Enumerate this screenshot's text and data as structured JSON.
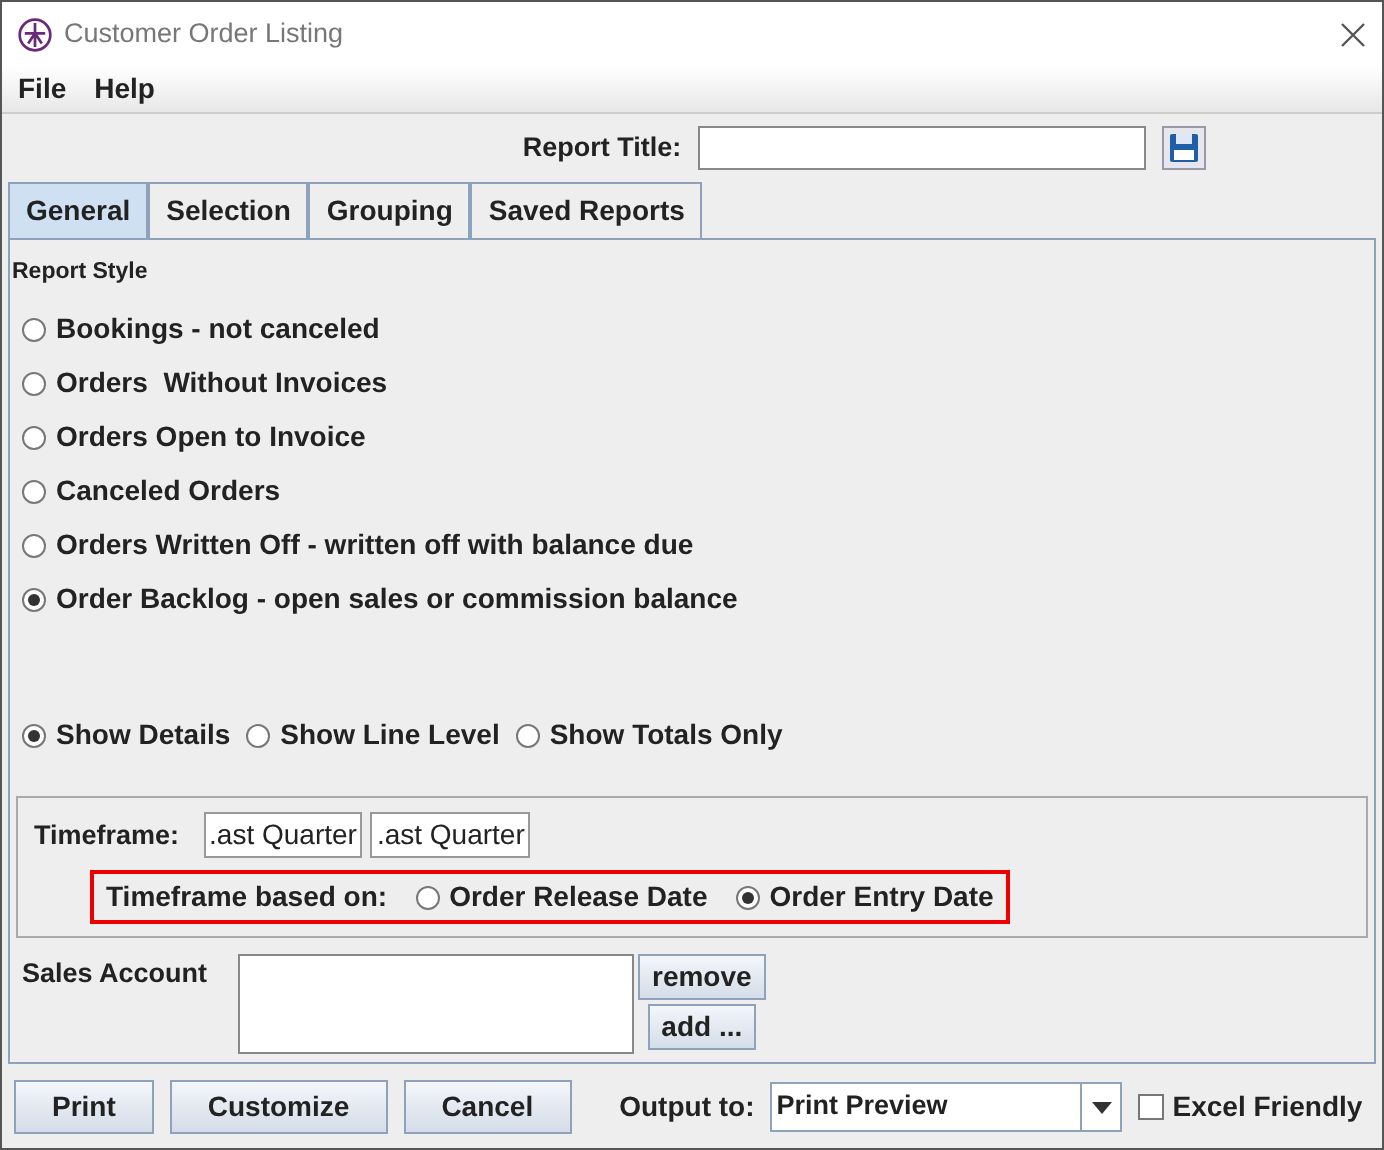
{
  "window": {
    "title": "Customer Order Listing"
  },
  "menu": [
    "File",
    "Help"
  ],
  "report_title": {
    "label": "Report Title:"
  },
  "tabs": [
    {
      "label": "General",
      "selected": true
    },
    {
      "label": "Selection",
      "selected": false
    },
    {
      "label": "Grouping",
      "selected": false
    },
    {
      "label": "Saved Reports",
      "selected": false
    }
  ],
  "report_style": {
    "heading": "Report Style",
    "options": [
      {
        "label": "Bookings - not canceled",
        "selected": false
      },
      {
        "label": "Orders  Without Invoices",
        "selected": false
      },
      {
        "label": "Orders Open to Invoice",
        "selected": false
      },
      {
        "label": "Canceled Orders",
        "selected": false
      },
      {
        "label": "Orders Written Off - written off with balance due",
        "selected": false
      },
      {
        "label": "Order Backlog - open sales or commission balance",
        "selected": true
      }
    ]
  },
  "detail_options": [
    {
      "label": "Show Details",
      "selected": true
    },
    {
      "label": "Show Line Level",
      "selected": false
    },
    {
      "label": "Show Totals Only",
      "selected": false
    }
  ],
  "timeframe": {
    "label": "Timeframe:",
    "values": [
      ".ast Quarter",
      ".ast Quarter"
    ],
    "based_on": {
      "label": "Timeframe based on:",
      "options": [
        {
          "label": "Order Release Date",
          "selected": false
        },
        {
          "label": "Order Entry Date",
          "selected": true
        }
      ]
    }
  },
  "sales_account": {
    "label": "Sales Account",
    "buttons": [
      "remove",
      "add ..."
    ]
  },
  "buttons": [
    "Print",
    "Customize",
    "Cancel"
  ],
  "output": {
    "label": "Output to:",
    "value": "Print Preview"
  },
  "excel_friendly": {
    "label": "Excel Friendly",
    "checked": false
  }
}
